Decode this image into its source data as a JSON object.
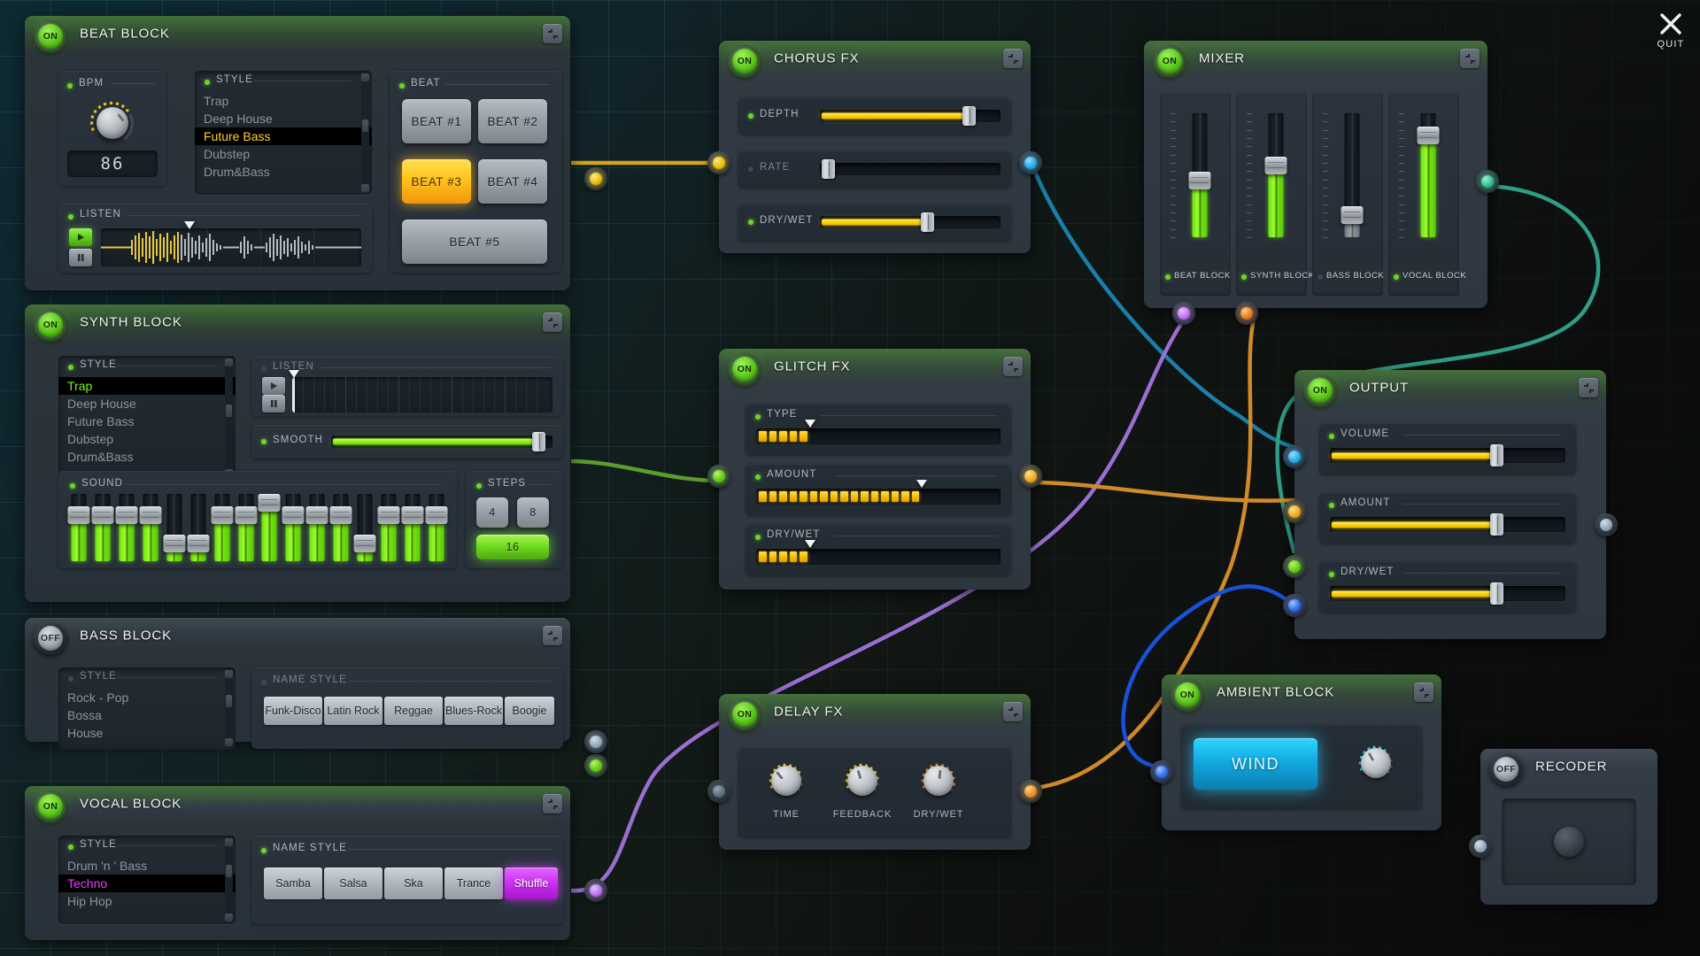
{
  "app": {
    "quit_label": "QUIT",
    "close_icon": "close-icon",
    "on_label": "ON",
    "off_label": "OFF"
  },
  "beat_block": {
    "title": "BEAT BLOCK",
    "power": "ON",
    "bpm": {
      "label": "BPM",
      "value": "86"
    },
    "style": {
      "label": "STYLE",
      "items": [
        "Trap",
        "Deep House",
        "Future Bass",
        "Dubstep",
        "Drum&Bass"
      ],
      "selected": "Future Bass"
    },
    "listen": {
      "label": "LISTEN",
      "play_icon": "play-icon",
      "pause_icon": "pause-icon"
    },
    "beat": {
      "label": "BEAT",
      "buttons": [
        "BEAT #1",
        "BEAT #2",
        "BEAT #3",
        "BEAT #4",
        "BEAT #5"
      ],
      "selected": "BEAT #3"
    }
  },
  "synth_block": {
    "title": "SYNTH BLOCK",
    "power": "ON",
    "style": {
      "label": "STYLE",
      "items": [
        "Trap",
        "Deep House",
        "Future Bass",
        "Dubstep",
        "Drum&Bass"
      ],
      "selected": "Trap"
    },
    "listen": {
      "label": "LISTEN",
      "play_icon": "play-icon",
      "pause_icon": "pause-icon"
    },
    "smooth": {
      "label": "SMOOTH",
      "value": 93
    },
    "sound": {
      "label": "SOUND",
      "values": [
        68,
        68,
        68,
        68,
        26,
        26,
        68,
        68,
        88,
        68,
        68,
        68,
        26,
        68,
        68,
        68
      ]
    },
    "steps": {
      "label": "STEPS",
      "options": [
        "4",
        "8",
        "16"
      ],
      "selected": "16"
    }
  },
  "bass_block": {
    "title": "BASS BLOCK",
    "power": "OFF",
    "style": {
      "label": "STYLE",
      "items": [
        "Rock - Pop",
        "Bossa",
        "House"
      ],
      "selected": ""
    },
    "name_style": {
      "label": "NAME STYLE",
      "buttons": [
        "Funk-Disco",
        "Latin Rock",
        "Reggae",
        "Blues-Rock",
        "Boogie"
      ],
      "selected": ""
    }
  },
  "vocal_block": {
    "title": "VOCAL BLOCK",
    "power": "ON",
    "style": {
      "label": "STYLE",
      "items": [
        "Drum 'n ' Bass",
        "Techno",
        "Hip Hop"
      ],
      "selected": "Techno"
    },
    "name_style": {
      "label": "NAME STYLE",
      "buttons": [
        "Samba",
        "Salsa",
        "Ska",
        "Trance",
        "Shuffle"
      ],
      "selected": "Shuffle"
    }
  },
  "chorus_fx": {
    "title": "CHORUS FX",
    "power": "ON",
    "controls": [
      {
        "label": "DEPTH",
        "value": 80,
        "active": true
      },
      {
        "label": "RATE",
        "value": 2,
        "active": false
      },
      {
        "label": "DRY/WET",
        "value": 56,
        "active": true
      }
    ]
  },
  "glitch_fx": {
    "title": "GLITCH FX",
    "power": "ON",
    "controls": [
      {
        "label": "TYPE",
        "segments": 5,
        "total": 24,
        "marker": 5
      },
      {
        "label": "AMOUNT",
        "segments": 16,
        "total": 24,
        "marker": 16
      },
      {
        "label": "DRY/WET",
        "segments": 5,
        "total": 24,
        "marker": 5
      }
    ]
  },
  "delay_fx": {
    "title": "DELAY FX",
    "power": "ON",
    "knobs": [
      {
        "label": "TIME",
        "value": 35,
        "color": "#ffd400"
      },
      {
        "label": "FEEDBACK",
        "value": 45,
        "color": "#ffd400"
      },
      {
        "label": "DRY/WET",
        "value": 62,
        "color": "#ff8a1e"
      }
    ]
  },
  "mixer": {
    "title": "MIXER",
    "power": "ON",
    "channels": [
      {
        "label": "BEAT BLOCK",
        "value": 46,
        "on": true
      },
      {
        "label": "SYNTH BLOCK",
        "value": 58,
        "on": true
      },
      {
        "label": "BASS BLOCK",
        "value": 18,
        "on": false
      },
      {
        "label": "VOCAL BLOCK",
        "value": 82,
        "on": true
      }
    ]
  },
  "output": {
    "title": "OUTPUT",
    "power": "ON",
    "controls": [
      {
        "label": "VOLUME",
        "value": 70
      },
      {
        "label": "AMOUNT",
        "value": 70
      },
      {
        "label": "DRY/WET",
        "value": 70
      }
    ]
  },
  "ambient_block": {
    "title": "AMBIENT BLOCK",
    "power": "ON",
    "preset_label": "WIND",
    "knob_value": 55
  },
  "recorder": {
    "title": "RECODER",
    "power": "OFF"
  },
  "colors": {
    "accent_green": "#6bd62a",
    "accent_yellow": "#ffd400",
    "accent_magenta": "#cc2ef0",
    "accent_cyan": "#12a9e0",
    "accent_orange": "#e08a24"
  }
}
